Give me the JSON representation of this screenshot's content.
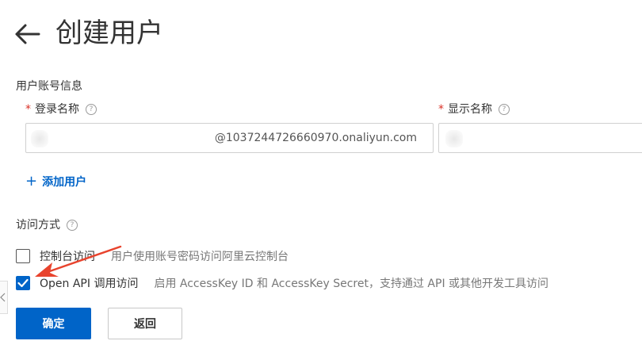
{
  "header": {
    "title": "创建用户"
  },
  "account_section": {
    "title": "用户账号信息",
    "login_name": {
      "label": "登录名称",
      "value": "",
      "suffix": "@1037244726660970.onaliyun.com"
    },
    "display_name": {
      "label": "显示名称",
      "value": ""
    },
    "add_user_label": "添加用户"
  },
  "access_section": {
    "title": "访问方式",
    "options": [
      {
        "label": "控制台访问",
        "description": "用户使用账号密码访问阿里云控制台",
        "checked": false
      },
      {
        "label": "Open API 调用访问",
        "description": "启用 AccessKey ID 和 AccessKey Secret，支持通过 API 或其他开发工具访问",
        "checked": true
      }
    ]
  },
  "actions": {
    "confirm_label": "确定",
    "back_label": "返回"
  },
  "icons": {
    "back": "arrow-left-icon",
    "help": "question-circle-icon",
    "add": "plus-icon",
    "check": "checkmark-icon",
    "side": "chevron-left-icon",
    "annotation": "red-arrow-icon"
  },
  "colors": {
    "primary": "#0064c8",
    "required": "#d93026",
    "annotation": "#e8432d"
  }
}
